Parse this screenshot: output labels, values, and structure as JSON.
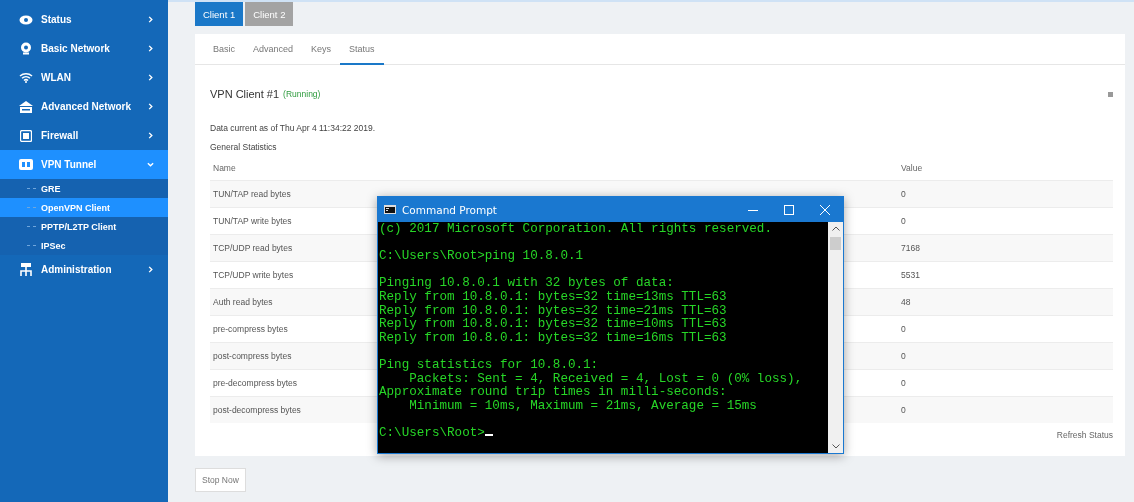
{
  "sidebar": {
    "items": [
      {
        "label": "Status",
        "expanded": false
      },
      {
        "label": "Basic Network",
        "expanded": false
      },
      {
        "label": "WLAN",
        "expanded": false
      },
      {
        "label": "Advanced Network",
        "expanded": false
      },
      {
        "label": "Firewall",
        "expanded": false
      },
      {
        "label": "VPN Tunnel",
        "expanded": true,
        "children": [
          {
            "label": "GRE",
            "selected": false
          },
          {
            "label": "OpenVPN Client",
            "selected": true
          },
          {
            "label": "PPTP/L2TP Client",
            "selected": false
          },
          {
            "label": "IPSec",
            "selected": false
          }
        ]
      },
      {
        "label": "Administration",
        "expanded": false
      }
    ]
  },
  "client_tabs": [
    {
      "label": "Client 1",
      "selected": true
    },
    {
      "label": "Client 2",
      "selected": false
    }
  ],
  "tabs": [
    {
      "label": "Basic",
      "selected": false
    },
    {
      "label": "Advanced",
      "selected": false
    },
    {
      "label": "Keys",
      "selected": false
    },
    {
      "label": "Status",
      "selected": true
    }
  ],
  "section": {
    "title": "VPN Client #1",
    "status": "(Running)",
    "data_time": "Data current as of Thu Apr 4 11:34:22 2019.",
    "subtitle": "General Statistics"
  },
  "table": {
    "columns": [
      "Name",
      "Value"
    ],
    "rows": [
      [
        "TUN/TAP read bytes",
        "0"
      ],
      [
        "TUN/TAP write bytes",
        "0"
      ],
      [
        "TCP/UDP read bytes",
        "7168"
      ],
      [
        "TCP/UDP write bytes",
        "5531"
      ],
      [
        "Auth read bytes",
        "48"
      ],
      [
        "pre-compress bytes",
        "0"
      ],
      [
        "post-compress bytes",
        "0"
      ],
      [
        "pre-decompress bytes",
        "0"
      ],
      [
        "post-decompress bytes",
        "0"
      ]
    ]
  },
  "refresh_link": "Refresh Status",
  "stop_button": "Stop Now",
  "command_prompt": {
    "title": "Command Prompt",
    "blocks": [
      [
        "(c) 2017 Microsoft Corporation. All rights reserved."
      ],
      [
        "C:\\Users\\Root>ping 10.8.0.1"
      ],
      [
        "Pinging 10.8.0.1 with 32 bytes of data:",
        "Reply from 10.8.0.1: bytes=32 time=13ms TTL=63",
        "Reply from 10.8.0.1: bytes=32 time=21ms TTL=63",
        "Reply from 10.8.0.1: bytes=32 time=10ms TTL=63",
        "Reply from 10.8.0.1: bytes=32 time=16ms TTL=63"
      ],
      [
        "Ping statistics for 10.8.0.1:",
        "    Packets: Sent = 4, Received = 4, Lost = 0 (0% loss),",
        "Approximate round trip times in milli-seconds:",
        "    Minimum = 10ms, Maximum = 21ms, Average = 15ms"
      ],
      [
        "C:\\Users\\Root>"
      ]
    ]
  }
}
